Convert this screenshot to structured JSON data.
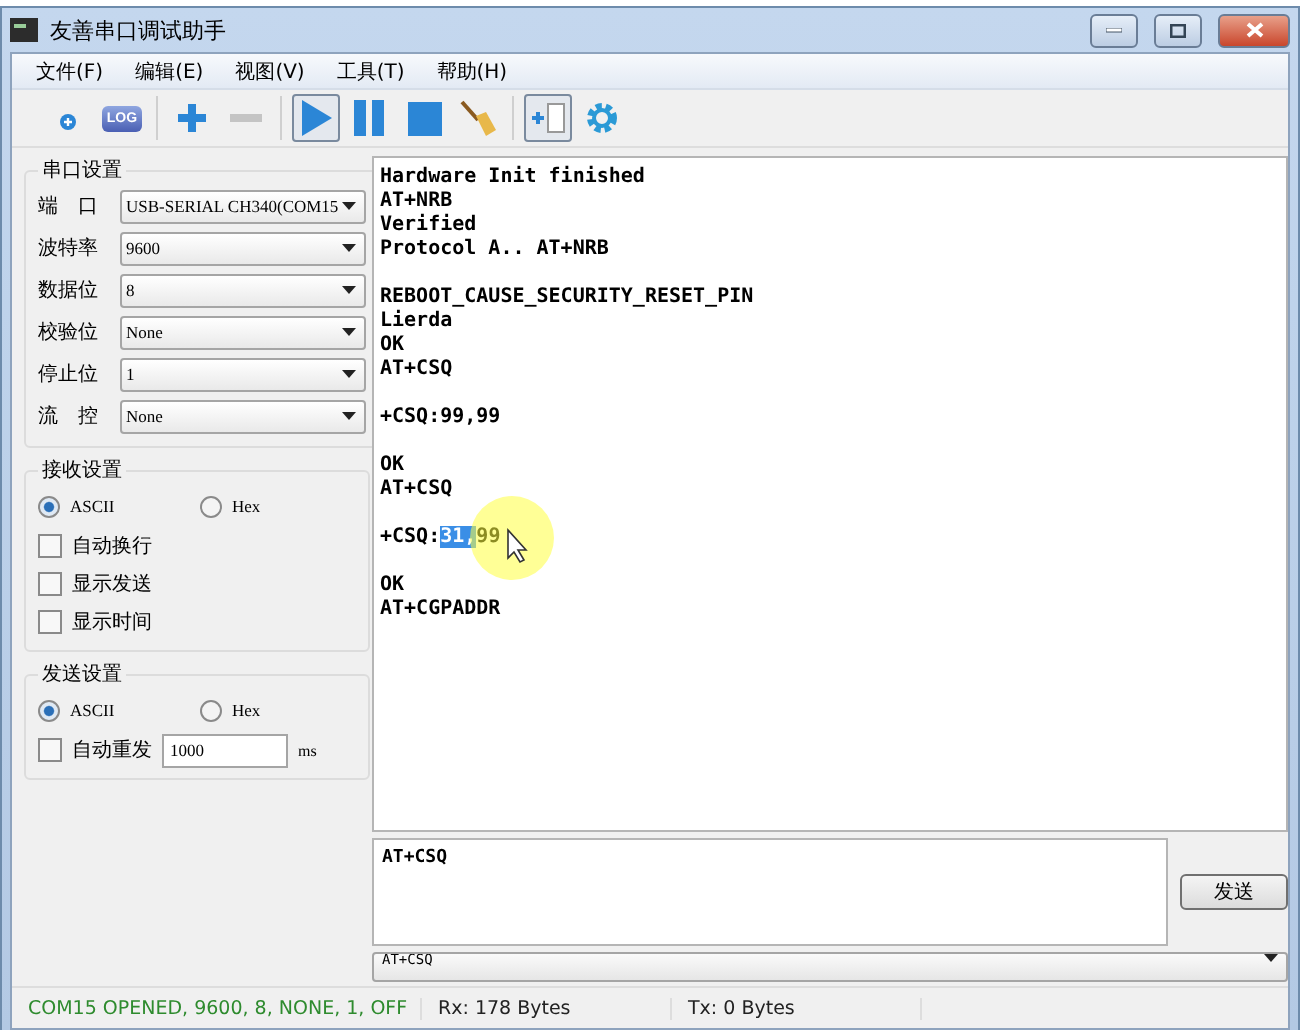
{
  "window": {
    "title": "友善串口调试助手"
  },
  "menu": [
    "文件(F)",
    "编辑(E)",
    "视图(V)",
    "工具(T)",
    "帮助(H)"
  ],
  "toolbar": [
    {
      "kind": "connect",
      "pressed": false
    },
    {
      "kind": "log",
      "label": "LOG",
      "pressed": false
    },
    {
      "kind": "sep"
    },
    {
      "kind": "plus",
      "pressed": false
    },
    {
      "kind": "minus",
      "pressed": false
    },
    {
      "kind": "sep"
    },
    {
      "kind": "play",
      "pressed": true
    },
    {
      "kind": "pause",
      "pressed": false
    },
    {
      "kind": "stop",
      "pressed": false
    },
    {
      "kind": "broom",
      "pressed": false
    },
    {
      "kind": "sep"
    },
    {
      "kind": "addbox",
      "pressed": true
    },
    {
      "kind": "gear",
      "pressed": false
    }
  ],
  "serial_settings": {
    "title": "串口设置",
    "fields": [
      {
        "label": "端　口",
        "value": "USB-SERIAL CH340(COM15"
      },
      {
        "label": "波特率",
        "value": "9600"
      },
      {
        "label": "数据位",
        "value": "8"
      },
      {
        "label": "校验位",
        "value": "None"
      },
      {
        "label": "停止位",
        "value": "1"
      },
      {
        "label": "流　控",
        "value": "None"
      }
    ]
  },
  "receive_settings": {
    "title": "接收设置",
    "radios": [
      {
        "label": "ASCII",
        "selected": true
      },
      {
        "label": "Hex",
        "selected": false
      }
    ],
    "checkboxes": [
      {
        "label": "自动换行",
        "checked": false
      },
      {
        "label": "显示发送",
        "checked": false
      },
      {
        "label": "显示时间",
        "checked": false
      }
    ]
  },
  "send_settings": {
    "title": "发送设置",
    "radios": [
      {
        "label": "ASCII",
        "selected": true
      },
      {
        "label": "Hex",
        "selected": false
      }
    ],
    "auto_resend": {
      "label": "自动重发",
      "checked": false,
      "interval": "1000",
      "unit": "ms"
    }
  },
  "log": [
    {
      "lines": [
        {
          "segments": [
            {
              "text": "Hardware Init finished",
              "selected": false
            }
          ]
        },
        {
          "segments": [
            {
              "text": "AT+NRB",
              "selected": false
            }
          ]
        },
        {
          "segments": [
            {
              "text": "Verified",
              "selected": false
            }
          ]
        },
        {
          "segments": [
            {
              "text": "Protocol A.. AT+NRB",
              "selected": false
            }
          ]
        }
      ]
    },
    {
      "lines": [
        {
          "segments": [
            {
              "text": "REBOOT_CAUSE_SECURITY_RESET_PIN",
              "selected": false
            }
          ]
        },
        {
          "segments": [
            {
              "text": "Lierda",
              "selected": false
            }
          ]
        },
        {
          "segments": [
            {
              "text": "OK",
              "selected": false
            }
          ]
        },
        {
          "segments": [
            {
              "text": "AT+CSQ",
              "selected": false
            }
          ]
        }
      ]
    },
    {
      "lines": [
        {
          "segments": [
            {
              "text": "+CSQ:99,99",
              "selected": false
            }
          ]
        }
      ]
    },
    {
      "lines": [
        {
          "segments": [
            {
              "text": "OK",
              "selected": false
            }
          ]
        },
        {
          "segments": [
            {
              "text": "AT+CSQ",
              "selected": false
            }
          ]
        }
      ]
    },
    {
      "lines": [
        {
          "segments": [
            {
              "text": "+CSQ:",
              "selected": false
            },
            {
              "text": "31,",
              "selected": true
            },
            {
              "text": "99",
              "selected": false
            }
          ],
          "cursor": true
        }
      ]
    },
    {
      "lines": [
        {
          "segments": [
            {
              "text": "OK",
              "selected": false
            }
          ]
        },
        {
          "segments": [
            {
              "text": "AT+CGPADDR",
              "selected": false
            }
          ]
        }
      ]
    }
  ],
  "send_box": {
    "value": "AT+CSQ"
  },
  "send_button": "发送",
  "history": {
    "value": "AT+CSQ"
  },
  "status_bar": [
    "COM15 OPENED, 9600, 8, NONE, 1, OFF",
    "Rx: 178 Bytes",
    "Tx: 0 Bytes"
  ]
}
